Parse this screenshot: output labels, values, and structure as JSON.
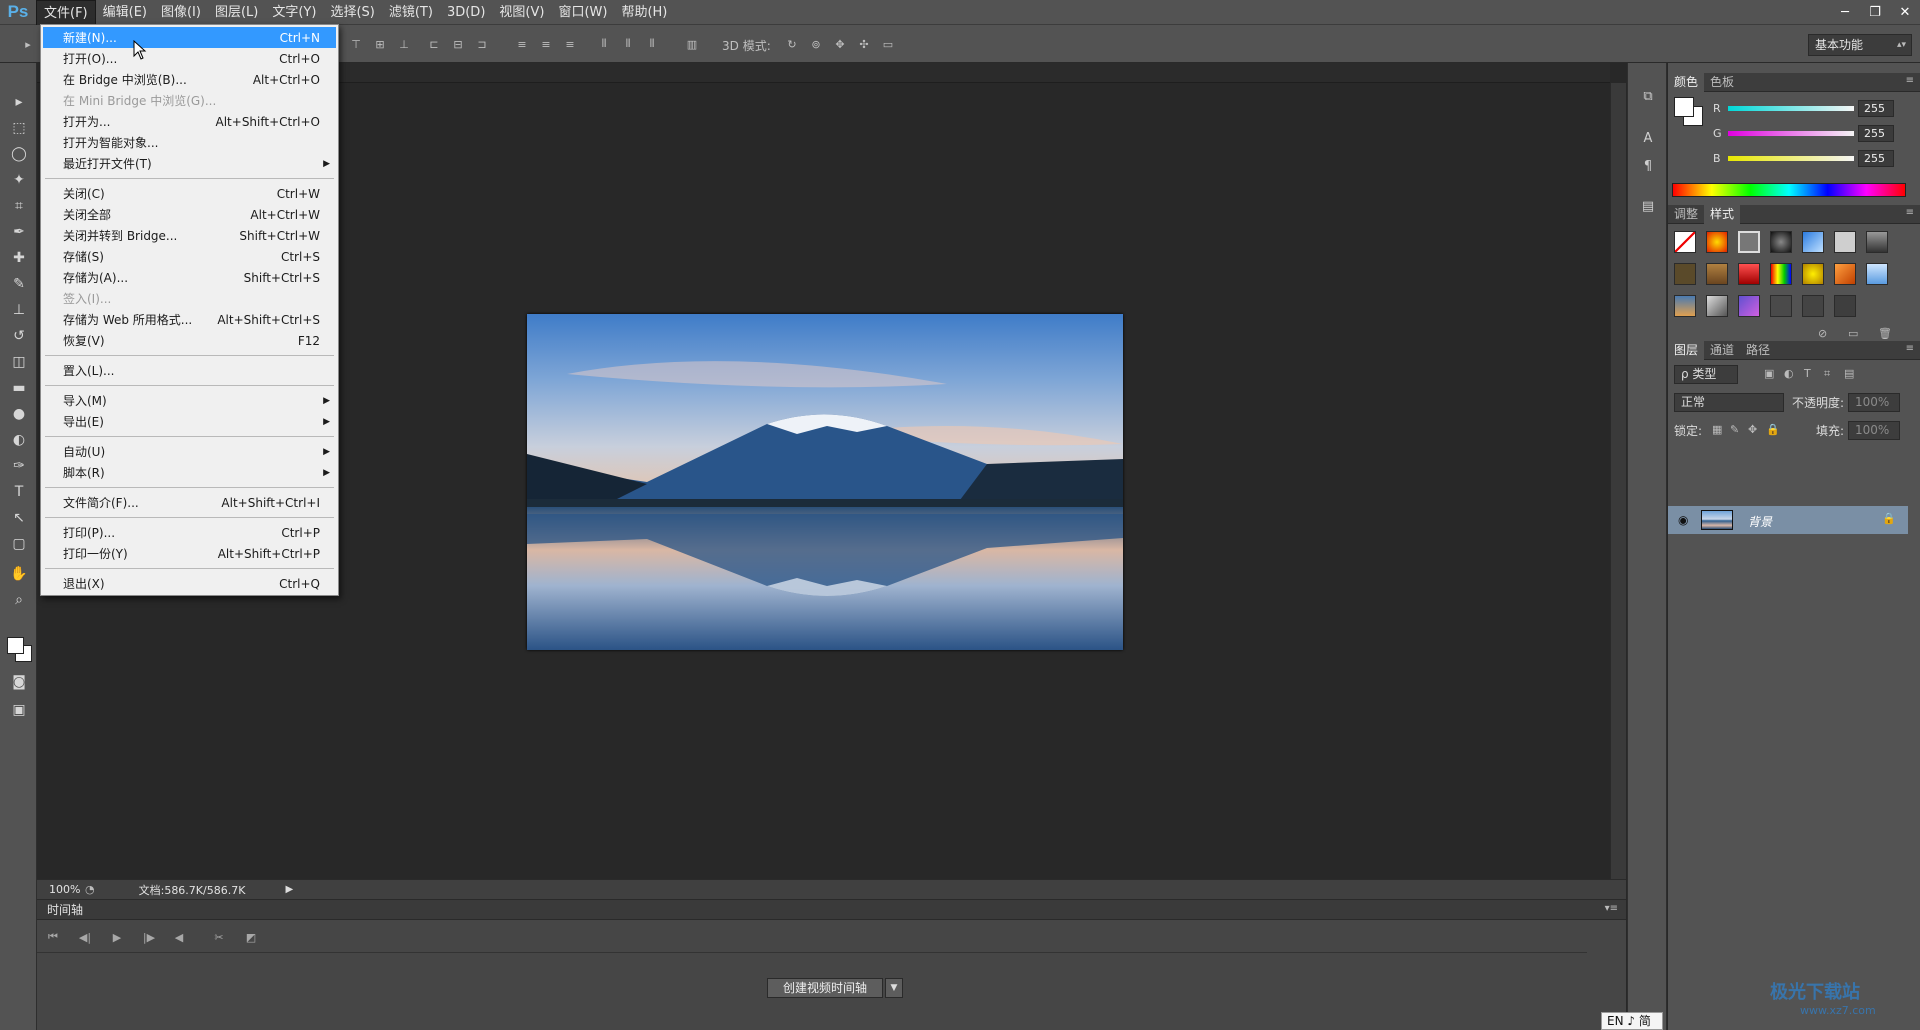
{
  "app": {
    "logo": "Ps",
    "menus": [
      "文件(F)",
      "编辑(E)",
      "图像(I)",
      "图层(L)",
      "文字(Y)",
      "选择(S)",
      "滤镜(T)",
      "3D(D)",
      "视图(V)",
      "窗口(W)",
      "帮助(H)"
    ],
    "window_controls": [
      "─",
      "❐",
      "✕"
    ]
  },
  "options_bar": {
    "mode3d_label": "3D 模式:",
    "workspace": "基本功能"
  },
  "file_menu": {
    "items": [
      {
        "label": "新建(N)...",
        "shortcut": "Ctrl+N",
        "highlight": true
      },
      {
        "label": "打开(O)...",
        "shortcut": "Ctrl+O"
      },
      {
        "label": "在 Bridge 中浏览(B)...",
        "shortcut": "Alt+Ctrl+O"
      },
      {
        "label": "在 Mini Bridge 中浏览(G)...",
        "shortcut": "",
        "disabled": true
      },
      {
        "label": "打开为...",
        "shortcut": "Alt+Shift+Ctrl+O"
      },
      {
        "label": "打开为智能对象...",
        "shortcut": ""
      },
      {
        "label": "最近打开文件(T)",
        "shortcut": "",
        "submenu": true
      },
      {
        "label": "关闭(C)",
        "shortcut": "Ctrl+W"
      },
      {
        "label": "关闭全部",
        "shortcut": "Alt+Ctrl+W"
      },
      {
        "label": "关闭并转到 Bridge...",
        "shortcut": "Shift+Ctrl+W"
      },
      {
        "label": "存储(S)",
        "shortcut": "Ctrl+S"
      },
      {
        "label": "存储为(A)...",
        "shortcut": "Shift+Ctrl+S"
      },
      {
        "label": "签入(I)...",
        "shortcut": "",
        "disabled": true
      },
      {
        "label": "存储为 Web 所用格式...",
        "shortcut": "Alt+Shift+Ctrl+S"
      },
      {
        "label": "恢复(V)",
        "shortcut": "F12"
      },
      {
        "label": "置入(L)...",
        "shortcut": ""
      },
      {
        "label": "导入(M)",
        "shortcut": "",
        "submenu": true
      },
      {
        "label": "导出(E)",
        "shortcut": "",
        "submenu": true
      },
      {
        "label": "自动(U)",
        "shortcut": "",
        "submenu": true
      },
      {
        "label": "脚本(R)",
        "shortcut": "",
        "submenu": true
      },
      {
        "label": "文件简介(F)...",
        "shortcut": "Alt+Shift+Ctrl+I"
      },
      {
        "label": "打印(P)...",
        "shortcut": "Ctrl+P"
      },
      {
        "label": "打印一份(Y)",
        "shortcut": "Alt+Shift+Ctrl+P"
      },
      {
        "label": "退出(X)",
        "shortcut": "Ctrl+Q"
      }
    ]
  },
  "status": {
    "zoom": "100%",
    "doc_info": "文档:586.7K/586.7K"
  },
  "timeline": {
    "title": "时间轴",
    "create_button": "创建视频时间轴"
  },
  "color_panel": {
    "tabs": [
      "颜色",
      "色板"
    ],
    "channels": [
      {
        "label": "R",
        "value": "255",
        "color": "#00d8d8"
      },
      {
        "label": "G",
        "value": "255",
        "color": "#e000e0"
      },
      {
        "label": "B",
        "value": "255",
        "color": "#e8e800"
      }
    ]
  },
  "styles_panel": {
    "tabs": [
      "调整",
      "样式"
    ]
  },
  "layers_panel": {
    "tabs": [
      "图层",
      "通道",
      "路径"
    ],
    "filter_label": "ρ 类型",
    "blend_mode": "正常",
    "opacity_label": "不透明度:",
    "opacity_value": "100%",
    "lock_label": "锁定:",
    "fill_label": "填充:",
    "fill_value": "100%",
    "layer_name": "背景"
  },
  "ime": "EN ♪ 简",
  "watermark": {
    "title": "极光下载站",
    "url": "www.xz7.com"
  }
}
